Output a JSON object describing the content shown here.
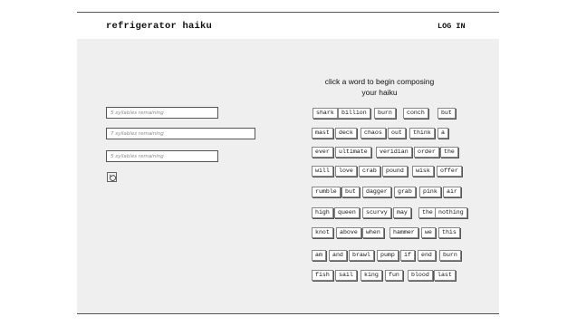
{
  "header": {
    "brand": "refrigerator haiku",
    "login": "LOG IN"
  },
  "composer": {
    "lines": [
      {
        "placeholder": "5 syllables remaining"
      },
      {
        "placeholder": "7 syllables remaining"
      },
      {
        "placeholder": "5 syllables remaining"
      }
    ]
  },
  "prompt": {
    "line1": "click a word to begin composing",
    "line2": "your haiku"
  },
  "words": [
    [
      "shark",
      "billion",
      "burn",
      "conch",
      "but"
    ],
    [
      "mast",
      "deck",
      "chaos",
      "out",
      "think",
      "a"
    ],
    [
      "ever",
      "ultimate",
      "veridian",
      "order",
      "the"
    ],
    [
      "will",
      "love",
      "crab",
      "pound",
      "wisk",
      "offer"
    ],
    [
      "rumble",
      "but",
      "dagger",
      "grab",
      "pink",
      "air"
    ],
    [
      "high",
      "queen",
      "scurvy",
      "may",
      "the",
      "nothing"
    ],
    [
      "knot",
      "above",
      "when",
      "hammer",
      "we",
      "this"
    ],
    [
      "am",
      "and",
      "brawl",
      "pump",
      "if",
      "end",
      "burn"
    ],
    [
      "fish",
      "sail",
      "king",
      "fun",
      "blood",
      "last"
    ]
  ]
}
